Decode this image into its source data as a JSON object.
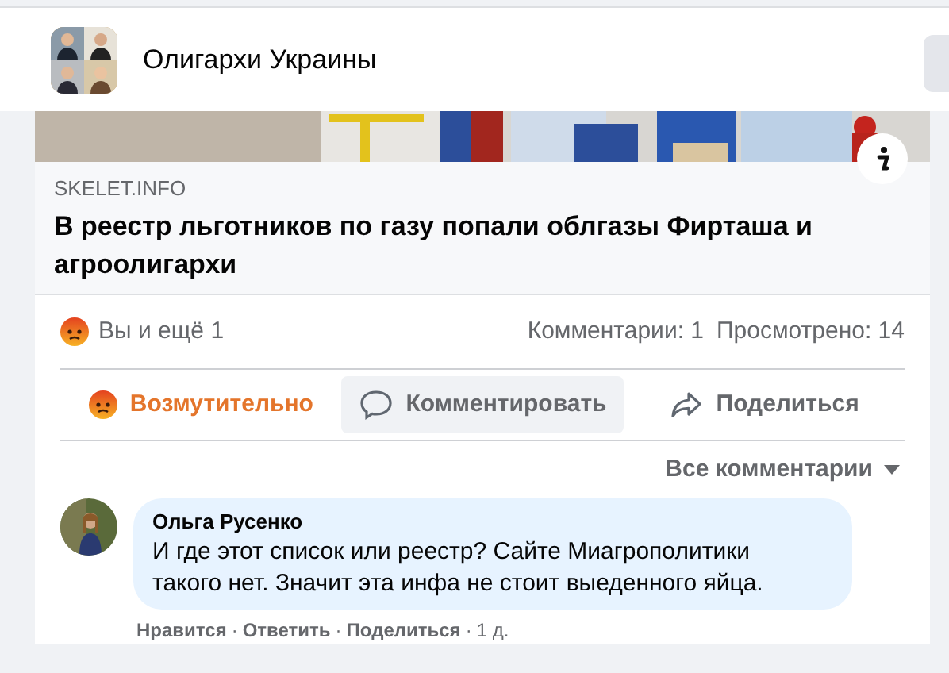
{
  "header": {
    "title": "Олигархи Украины"
  },
  "preview": {
    "source": "SKELET.INFO",
    "headline": "В реестр льготников по газу попали облгазы Фирташа и агроолигархи"
  },
  "stats": {
    "reactions": "Вы и ещё 1",
    "comments": "Комментарии: 1",
    "views": "Просмотрено: 14"
  },
  "actions": [
    {
      "kind": "react",
      "label": "Возмутительно",
      "selected": true
    },
    {
      "kind": "comment",
      "label": "Комментировать",
      "selected": false
    },
    {
      "kind": "share",
      "label": "Поделиться",
      "selected": false
    }
  ],
  "sort": {
    "label": "Все комментарии"
  },
  "comments": [
    {
      "author": "Ольга Русенко",
      "text": "И где этот список или реестр? Сайте Миагрополитики такого нет. Значит эта инфа не стоит выеденного яйца.",
      "links": [
        "Нравится",
        "Ответить",
        "Поделиться"
      ],
      "separator": "·",
      "time": "1 д."
    }
  ]
}
